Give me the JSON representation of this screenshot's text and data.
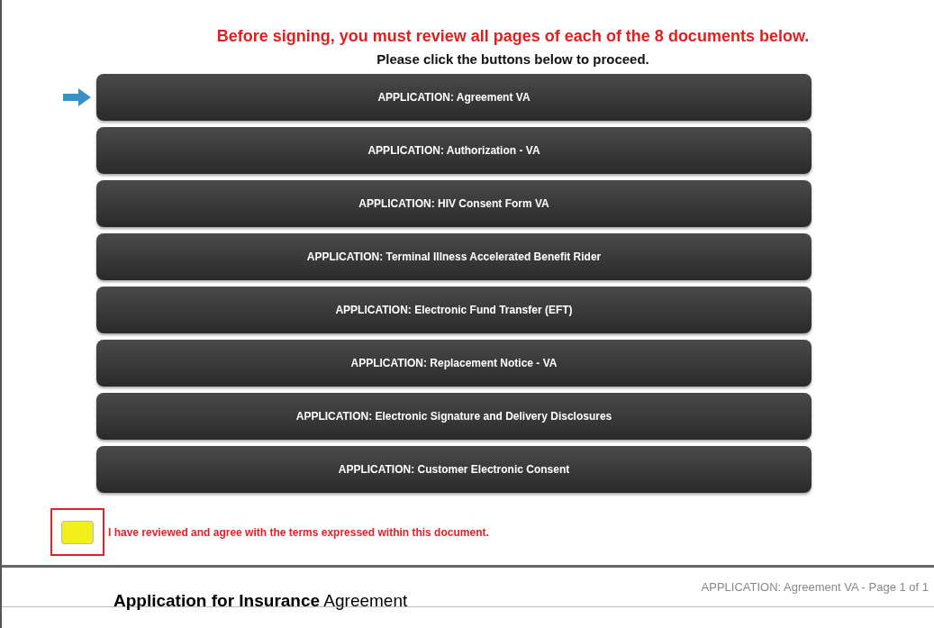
{
  "instructions": {
    "warning": "Before signing, you must review all pages of each of the 8 documents below.",
    "prompt": "Please click the buttons below to proceed."
  },
  "documents": [
    {
      "label": "APPLICATION: Agreement VA",
      "current": true
    },
    {
      "label": "APPLICATION: Authorization - VA",
      "current": false
    },
    {
      "label": "APPLICATION: HIV Consent Form VA",
      "current": false
    },
    {
      "label": "APPLICATION: Terminal Illness Accelerated Benefit Rider",
      "current": false
    },
    {
      "label": "APPLICATION: Electronic Fund Transfer (EFT)",
      "current": false
    },
    {
      "label": "APPLICATION: Replacement Notice - VA",
      "current": false
    },
    {
      "label": "APPLICATION: Electronic Signature and Delivery Disclosures",
      "current": false
    },
    {
      "label": "APPLICATION: Customer Electronic Consent",
      "current": false
    }
  ],
  "agreement": {
    "label": "I have reviewed and agree with the terms expressed within this document.",
    "checked": false,
    "highlighted": true
  },
  "document_header": {
    "title": "Application for Insurance",
    "subtitle": "Agreement",
    "page_info": "APPLICATION: Agreement VA - Page 1 of 1"
  }
}
